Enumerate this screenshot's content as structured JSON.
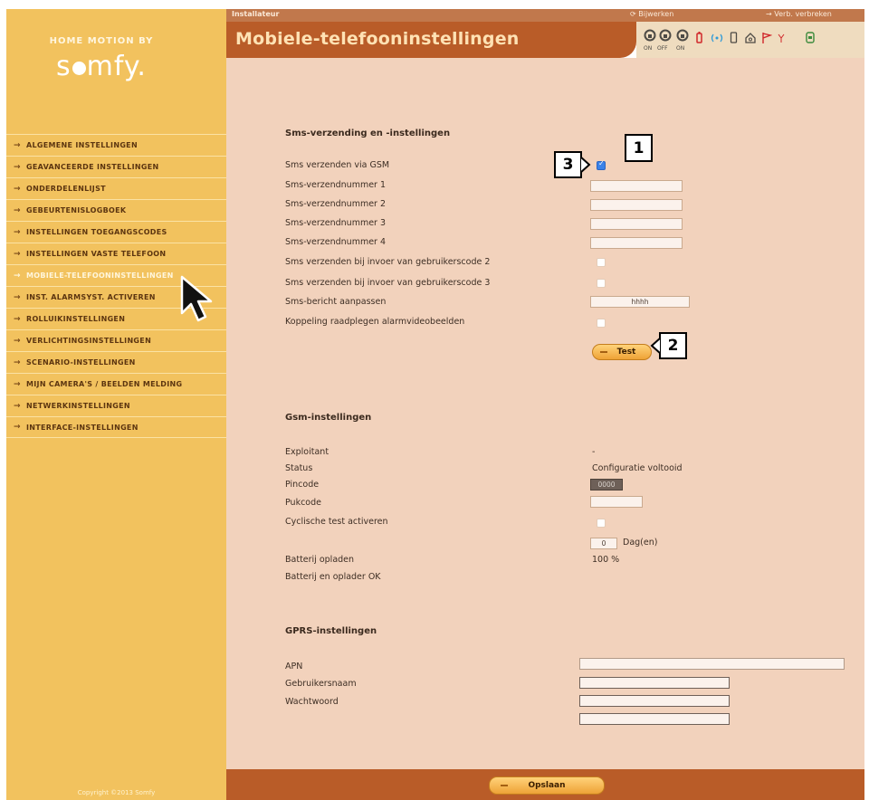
{
  "app": {
    "brand_line1": "HOME MOTION BY",
    "brand_logo": "somfy."
  },
  "topbar": {
    "role": "Installateur",
    "update_label": "Bijwerken",
    "disconnect_label": "Verb. verbreken"
  },
  "header": {
    "title": "Mobiele-telefooninstellingen",
    "status_icons": [
      {
        "name": "alarm-on-icon",
        "caption": "ON"
      },
      {
        "name": "alarm-off-icon",
        "caption": "OFF"
      },
      {
        "name": "alarm-partial-icon",
        "caption": "ON"
      },
      {
        "name": "battery-icon"
      },
      {
        "name": "radio-signal-icon"
      },
      {
        "name": "phone-icon"
      },
      {
        "name": "home-icon"
      },
      {
        "name": "flag-icon"
      },
      {
        "name": "antenna-icon"
      },
      {
        "name": "sim-icon"
      }
    ]
  },
  "sidebar": {
    "items": [
      {
        "label": "ALGEMENE INSTELLINGEN"
      },
      {
        "label": "GEAVANCEERDE INSTELLINGEN"
      },
      {
        "label": "ONDERDELENLIJST"
      },
      {
        "label": "GEBEURTENISLOGBOEK"
      },
      {
        "label": "INSTELLINGEN TOEGANGSCODES"
      },
      {
        "label": "INSTELLINGEN VASTE TELEFOON"
      },
      {
        "label": "MOBIELE-TELEFOONINSTELLINGEN",
        "active": true
      },
      {
        "label": "INST. ALARMSYST. ACTIVEREN"
      },
      {
        "label": "ROLLUIKINSTELLINGEN"
      },
      {
        "label": "VERLICHTINGSINSTELLINGEN"
      },
      {
        "label": "SCENARIO-INSTELLINGEN"
      },
      {
        "label": "MIJN CAMERA'S / BEELDEN MELDING"
      },
      {
        "label": "NETWERKINSTELLINGEN"
      },
      {
        "label": "INTERFACE-INSTELLINGEN"
      }
    ],
    "copyright": "Copyright ©2013 Somfy"
  },
  "sms": {
    "heading": "Sms-verzending en -instellingen",
    "send_via_gsm_label": "Sms verzenden via GSM",
    "send_via_gsm_checked": true,
    "number1_label": "Sms-verzendnummer 1",
    "number1_value": "",
    "number2_label": "Sms-verzendnummer 2",
    "number2_value": "",
    "number3_label": "Sms-verzendnummer 3",
    "number3_value": "",
    "number4_label": "Sms-verzendnummer 4",
    "number4_value": "",
    "usercode2_label": "Sms verzenden bij invoer van gebruikerscode 2",
    "usercode3_label": "Sms verzenden bij invoer van gebruikerscode 3",
    "message_label": "Sms-bericht aanpassen",
    "message_value": "hhhh",
    "video_label": "Koppeling raadplegen alarmvideobeelden",
    "test_button": "Test"
  },
  "gsm": {
    "heading": "Gsm-instellingen",
    "operator_label": "Exploitant",
    "operator_value": "-",
    "status_label": "Status",
    "status_value": "Configuratie voltooid",
    "pin_label": "Pincode",
    "pin_value": "0000",
    "puk_label": "Pukcode",
    "puk_value": "",
    "cyclic_label": "Cyclische test activeren",
    "days_value": "0",
    "days_unit": "Dag(en)",
    "battery_label": "Batterij opladen",
    "battery_value": "100 %",
    "battery_ok": "Batterij en oplader OK"
  },
  "gprs": {
    "heading": "GPRS-instellingen",
    "apn_label": "APN",
    "apn_value": "",
    "user_label": "Gebruikersnaam",
    "user_value": "",
    "password_label": "Wachtwoord",
    "password_value": "",
    "extra_value": ""
  },
  "footer": {
    "save_button": "Opslaan"
  },
  "callouts": {
    "c1": "1",
    "c2": "2",
    "c3": "3"
  }
}
